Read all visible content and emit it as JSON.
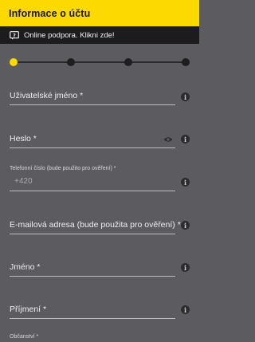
{
  "header": {
    "title": "Informace o účtu"
  },
  "support_banner": {
    "icon": "chat-question-icon",
    "text": "Online podpora. Klikni zde!"
  },
  "stepper": {
    "steps": 4,
    "current": 1
  },
  "form": {
    "username_label": "Uživatelské jméno *",
    "password_label": "Heslo *",
    "phone_label": "Telefonní číslo (bude použito pro ověření) *",
    "phone_value": "+420",
    "email_label": "E-mailová adresa (bude použita pro ověření) *",
    "first_name_label": "Jméno *",
    "last_name_label": "Příjmení *",
    "citizenship_label": "Občanství *"
  },
  "colors": {
    "accent": "#fcd900",
    "background": "#5b5b60",
    "support_bar": "#1c1c1e"
  }
}
